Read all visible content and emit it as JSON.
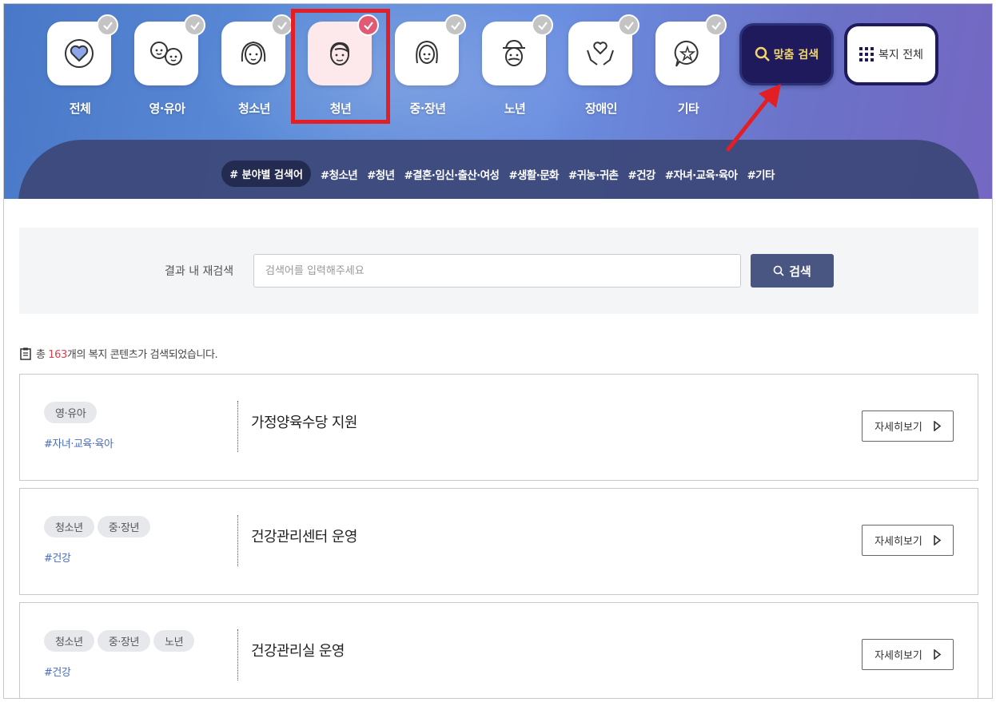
{
  "categories": [
    {
      "label": "전체",
      "icon": "heart-icon",
      "active": false
    },
    {
      "label": "영·유아",
      "icon": "babies-icon",
      "active": false
    },
    {
      "label": "청소년",
      "icon": "girl-icon",
      "active": false
    },
    {
      "label": "청년",
      "icon": "young-man-icon",
      "active": true
    },
    {
      "label": "중·장년",
      "icon": "woman-icon",
      "active": false
    },
    {
      "label": "노년",
      "icon": "elder-icon",
      "active": false
    },
    {
      "label": "장애인",
      "icon": "hands-heart-icon",
      "active": false
    },
    {
      "label": "기타",
      "icon": "star-bubble-icon",
      "active": false
    }
  ],
  "buttons": {
    "match_search": "맞춤 검색",
    "all_welfare": "복지 전체"
  },
  "tagbar": {
    "pill": "# 분야별 검색어",
    "tags": [
      "#청소년",
      "#청년",
      "#결혼·임신·출산·여성",
      "#생활·문화",
      "#귀농·귀촌",
      "#건강",
      "#자녀·교육·육아",
      "#기타"
    ]
  },
  "search": {
    "label": "결과 내 재검색",
    "placeholder": "검색어를 입력해주세요",
    "button": "검색"
  },
  "count": {
    "prefix": "총 ",
    "number": "163",
    "suffix": "개의 복지 콘텐츠가 검색되었습니다."
  },
  "results": [
    {
      "chips": [
        "영·유아"
      ],
      "hashtag": "#자녀·교육·육아",
      "title": "가정양육수당 지원",
      "more": "자세히보기"
    },
    {
      "chips": [
        "청소년",
        "중·장년"
      ],
      "hashtag": "#건강",
      "title": "건강관리센터 운영",
      "more": "자세히보기"
    },
    {
      "chips": [
        "청소년",
        "중·장년",
        "노년"
      ],
      "hashtag": "#건강",
      "title": "건강관리실 운영",
      "more": "자세히보기"
    }
  ],
  "colors": {
    "active_tile": "#fde8ec",
    "check_active": "#e15a74",
    "accent_yellow": "#f3d66b",
    "highlight_red": "#e31f26",
    "count_red": "#d9434e",
    "hashtag_blue": "#4a6cc0"
  }
}
